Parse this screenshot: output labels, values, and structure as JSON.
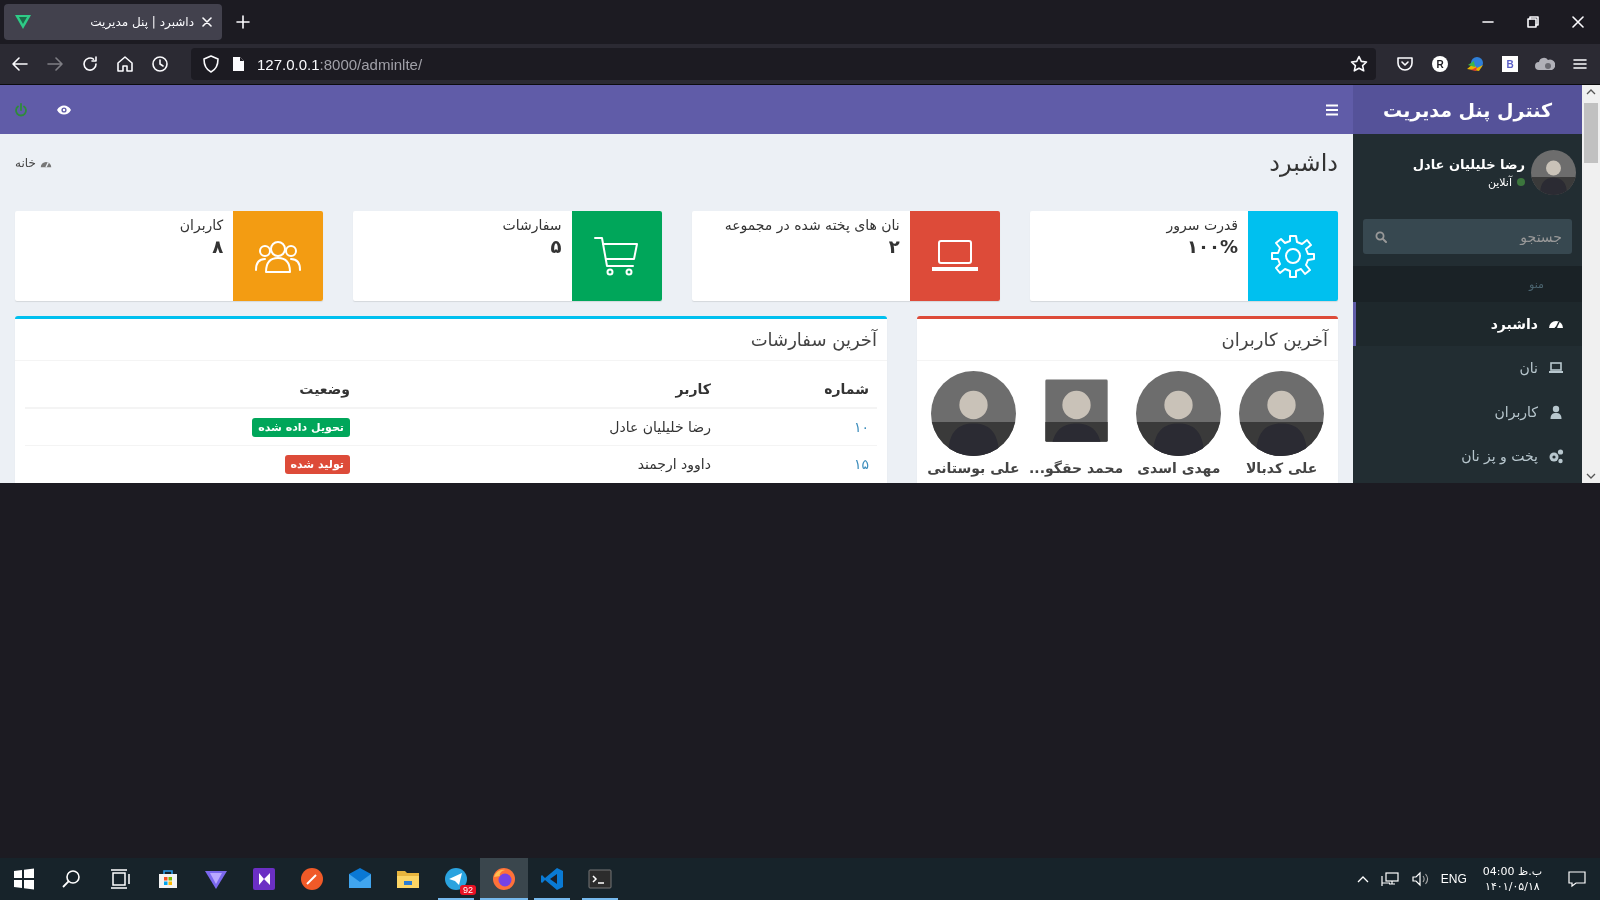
{
  "browser": {
    "tab_title": "داشبرد | پنل مدیریت",
    "url_host": "127.0.0.1",
    "url_path": ":8000/adminlte/",
    "round_badge": "R",
    "square_badge": "B"
  },
  "header": {
    "logo": "کنترل پنل مدیریت"
  },
  "sidebar": {
    "user": {
      "name": "رضا خلیلیان عادل",
      "status": "آنلاین",
      "online": true
    },
    "search": {
      "placeholder": "جستجو"
    },
    "menu_header": "منو",
    "items": [
      {
        "label": "داشبرد",
        "kind": "dashboard",
        "selected": true
      },
      {
        "label": "نان",
        "kind": "laptop",
        "selected": false
      },
      {
        "label": "کاربران",
        "kind": "user",
        "selected": false
      },
      {
        "label": "پخت و پز نان",
        "kind": "gears",
        "selected": false
      }
    ]
  },
  "content": {
    "title": "داشبرد",
    "breadcrumb": "خانه"
  },
  "info_boxes": [
    {
      "label": "قدرت سرور",
      "value": "۱۰۰%",
      "kind": "gear",
      "color": "#00c0ef"
    },
    {
      "label": "نان های پخته شده در مجموعه",
      "value": "۲",
      "kind": "laptop",
      "color": "#dd4b39"
    },
    {
      "label": "سفارشات",
      "value": "۵",
      "kind": "cart",
      "color": "#00a65a"
    },
    {
      "label": "کاربران",
      "value": "۸",
      "kind": "users",
      "color": "#f39c12"
    }
  ],
  "latest_users": {
    "title": "آخرین کاربران",
    "color": "#dd4b39",
    "users": [
      {
        "name": "علی کدبالا",
        "kind": "round"
      },
      {
        "name": "مهدی اسدی",
        "kind": "round"
      },
      {
        "name": "محمد حقگو...",
        "kind": "square"
      },
      {
        "name": "علی بوستانی",
        "kind": "round"
      }
    ]
  },
  "latest_orders": {
    "title": "آخرین سفارشات",
    "color": "#00c0ef",
    "columns": [
      "شماره",
      "کاربر",
      "وضعیت"
    ],
    "rows": [
      {
        "number": "۱۰",
        "user": "رضا خلیلیان عادل",
        "status": {
          "label": "تحویل داده شده",
          "color": "#00a65a"
        }
      },
      {
        "number": "۱۵",
        "user": "داوود ارجمند",
        "status": {
          "label": "تولید شده",
          "color": "#dd4b39"
        }
      }
    ]
  },
  "taskbar": {
    "apps": [
      {
        "kind": "start",
        "running": false,
        "selected": false
      },
      {
        "kind": "search",
        "running": false,
        "selected": false
      },
      {
        "kind": "taskview",
        "running": false,
        "selected": false
      },
      {
        "kind": "store",
        "running": false,
        "selected": false
      },
      {
        "kind": "triangle",
        "running": false,
        "selected": false
      },
      {
        "kind": "play",
        "running": false,
        "selected": false
      },
      {
        "kind": "pen",
        "running": false,
        "selected": false
      },
      {
        "kind": "mail",
        "running": false,
        "selected": false
      },
      {
        "kind": "folder",
        "running": false,
        "selected": false
      },
      {
        "kind": "plane",
        "running": true,
        "selected": false,
        "badge": "92"
      },
      {
        "kind": "fox",
        "running": true,
        "selected": true
      },
      {
        "kind": "code",
        "running": true,
        "selected": false
      },
      {
        "kind": "terminal",
        "running": true,
        "selected": false
      }
    ],
    "tray": {
      "language": "ENG",
      "time": "ب.ظ 04:00",
      "date": "۱۴۰۱/۰۵/۱۸"
    }
  }
}
